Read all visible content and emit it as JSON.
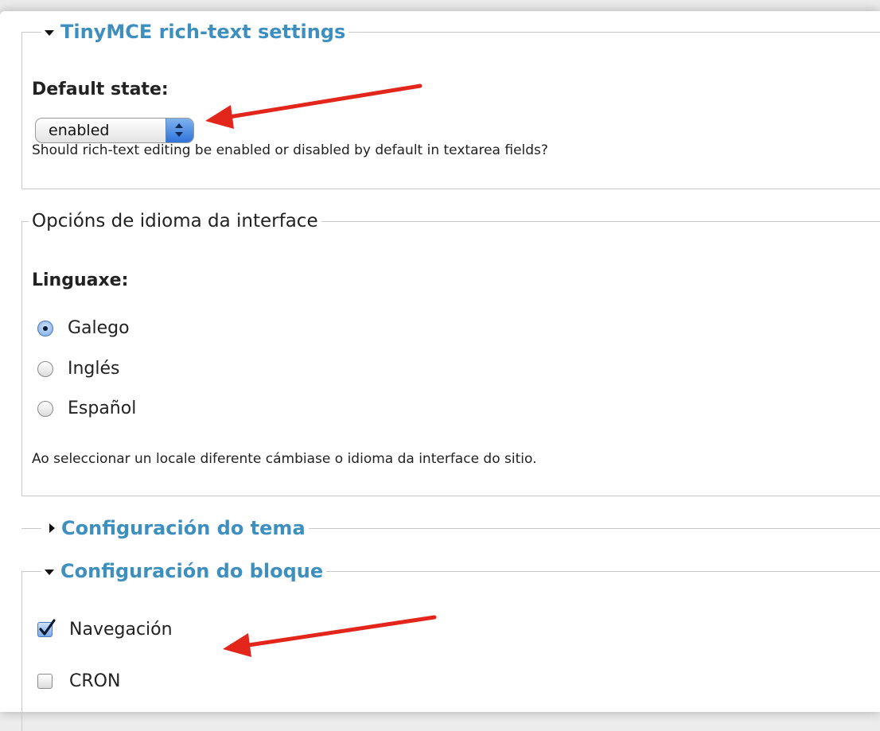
{
  "tinymce": {
    "legend": "TinyMCE rich-text settings",
    "default_state_label": "Default state:",
    "select_value": "enabled",
    "description": "Should rich-text editing be enabled or disabled by default in textarea fields?"
  },
  "language": {
    "legend": "Opcións de idioma da interface",
    "label": "Linguaxe:",
    "options": [
      {
        "label": "Galego",
        "selected": true
      },
      {
        "label": "Inglés",
        "selected": false
      },
      {
        "label": "Español",
        "selected": false
      }
    ],
    "description": "Ao seleccionar un locale diferente cámbiase o idioma da interface do sitio."
  },
  "theme": {
    "legend": "Configuración do tema",
    "collapsed": true
  },
  "blocks": {
    "legend": "Configuración do bloque",
    "items": [
      {
        "label": "Navegación",
        "checked": true
      },
      {
        "label": "CRON",
        "checked": false
      }
    ]
  },
  "colors": {
    "link": "#3d8fbf",
    "annotation_arrow": "#e3261b",
    "radio_selected": "#7aa8e6"
  }
}
